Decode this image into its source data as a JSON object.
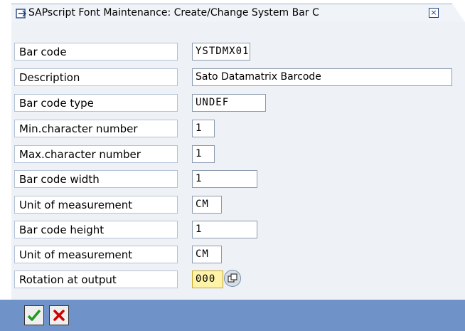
{
  "window": {
    "title": "SAPscript Font Maintenance: Create/Change System Bar C",
    "close_label": "×"
  },
  "rows": [
    {
      "label": "Bar code",
      "value": "YSTDMX01"
    },
    {
      "label": "Description",
      "value": "Sato Datamatrix Barcode"
    },
    {
      "label": "Bar code type",
      "value": "UNDEF"
    },
    {
      "label": "Min.character number",
      "value": "1"
    },
    {
      "label": "Max.character number",
      "value": "1"
    },
    {
      "label": "Bar code width",
      "value": "1"
    },
    {
      "label": "Unit of measurement",
      "value": "CM"
    },
    {
      "label": "Bar code height",
      "value": "1"
    },
    {
      "label": "Unit of measurement",
      "value": "CM"
    },
    {
      "label": "Rotation at output",
      "value": "000"
    }
  ],
  "icons": {
    "title": "window-icon",
    "value_help": "value-help-icon",
    "confirm": "checkmark-icon",
    "cancel": "cancel-x-icon"
  },
  "colors": {
    "footer": "#6f92c8",
    "panel": "#eef1f6",
    "required_field": "#fff3a8",
    "confirm": "#1e9b1e",
    "cancel": "#cc0000"
  }
}
